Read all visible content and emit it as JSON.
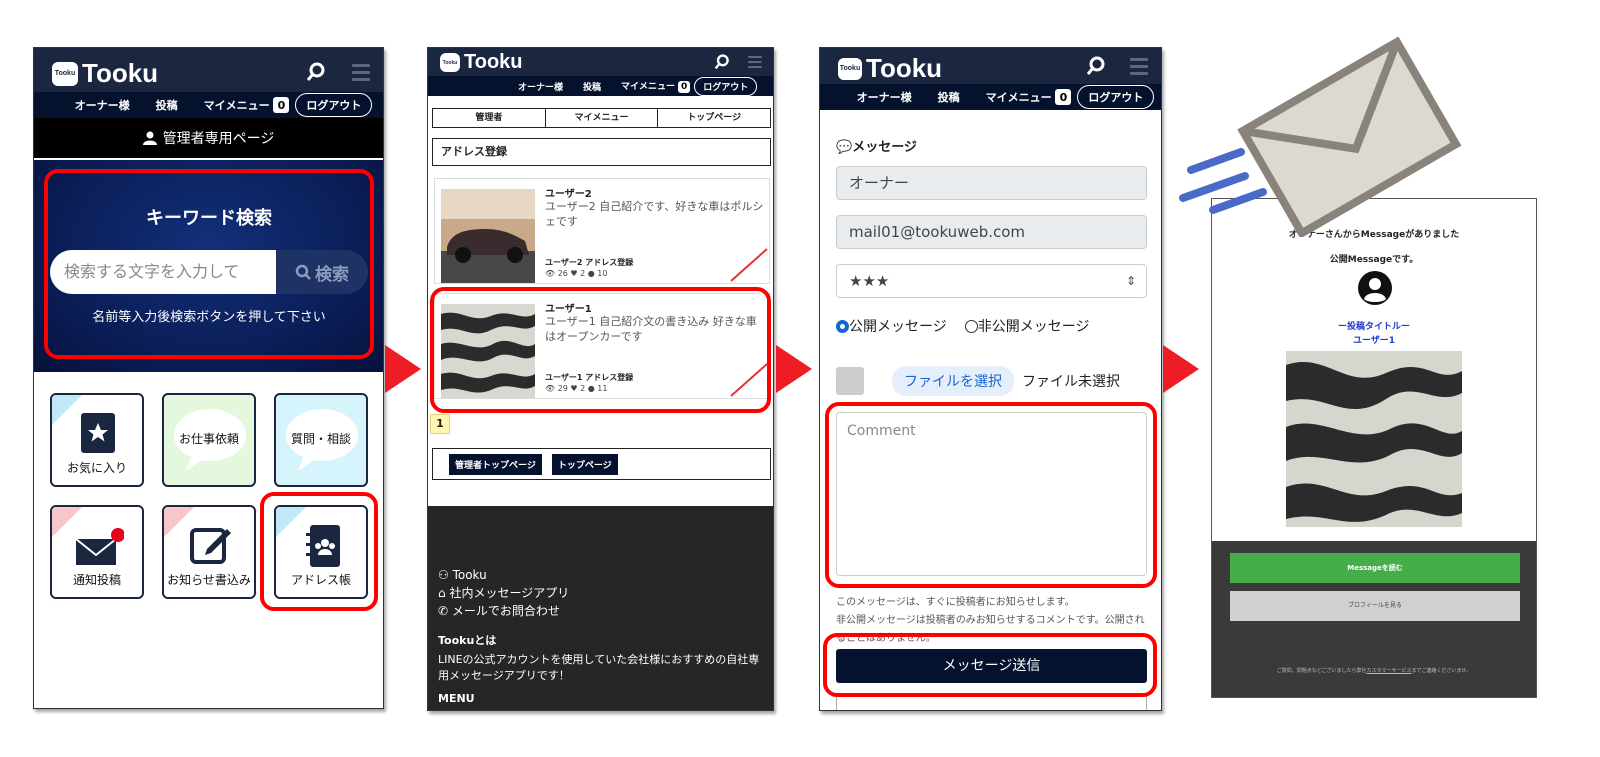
{
  "brand": "Tooku",
  "logo_mark": "Tooku",
  "nav": {
    "owner": "オーナー様",
    "post": "投稿",
    "mymenu": "マイメニュー",
    "badge": "0",
    "logout": "ログアウト"
  },
  "phone1": {
    "admin_bar": "管理者専用ページ",
    "search_title": "キーワード検索",
    "search_placeholder": "検索する文字を入力して",
    "search_button": "検索",
    "search_hint": "名前等入力後検索ボタンを押して下さい",
    "tiles": [
      "お気に入り",
      "お仕事依頼",
      "質問・相談",
      "通知投稿",
      "お知らせ書込み",
      "アドレス帳"
    ]
  },
  "phone2": {
    "tabs": [
      "管理者",
      "マイメニュー",
      "トップページ"
    ],
    "section_title": "アドレス登録",
    "cards": [
      {
        "name": "ユーザー2",
        "desc": "ユーザー2 自己紹介です、好きな車はポルシェです",
        "meta": "ユーザー2  アドレス登録",
        "stats": "26 ♥ 2 ● 10"
      },
      {
        "name": "ユーザー1",
        "desc": "ユーザー1 自己紹介文の書き込み 好きな車はオープンカーです",
        "meta": "ユーザー1  アドレス登録",
        "stats": "29 ♥ 2 ● 11"
      }
    ],
    "page_number": "1",
    "buttons": [
      "管理者トップページ",
      "トップページ"
    ],
    "footer_links": [
      "Tooku",
      "社内メッセージアプリ",
      "メールでお問合わせ"
    ],
    "about_title": "Tookuとは",
    "about_text": "LINEの公式アカウントを使用していた会社様におすすめの自社専用メッセージアプリです！",
    "menu_title": "MENU"
  },
  "phone3": {
    "heading": "メッセージ",
    "name_value": "オーナー",
    "email_value": "mail01@tookuweb.com",
    "stars_value": "★★★",
    "radio_public": "公開メッセージ",
    "radio_private": "非公開メッセージ",
    "file_button": "ファイルを選択",
    "file_status": "ファイル未選択",
    "comment_placeholder": "Comment",
    "note1": "このメッセージは、すぐに投稿者にお知らせします。",
    "note2": "非公開メッセージは投稿者のみお知らせするコメントです。公開されることはありません。",
    "send_button": "メッセージ送信"
  },
  "phone4": {
    "line1": "オーナーさんからMessageがありました",
    "line2": "公開Messageです。",
    "post_title": "ー投稿タイトルー",
    "user": "ユーザー1",
    "read_button": "Messageを読む",
    "profile_button": "プロフィールを見る",
    "footer_pre": "ご質問、問題点などございましたら弊社",
    "footer_link": "カスタマーサービス",
    "footer_post": "までご連絡くださいませ。"
  }
}
